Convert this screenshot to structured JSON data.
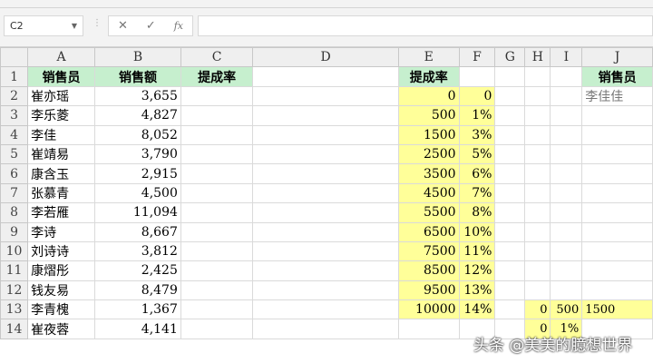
{
  "formula_bar": {
    "name_box": "C2",
    "cancel": "✕",
    "confirm": "✓",
    "fx": "fx",
    "value": ""
  },
  "columns": [
    "A",
    "B",
    "C",
    "D",
    "E",
    "F",
    "G",
    "H",
    "I",
    "J"
  ],
  "rows": [
    [
      "销售员",
      "销售额",
      "提成率",
      "",
      "提成率",
      "",
      "",
      "",
      "",
      "销售员"
    ],
    [
      "崔亦瑶",
      "3,655",
      "",
      "",
      "0",
      "0",
      "",
      "",
      "",
      "李佳佳"
    ],
    [
      "李乐菱",
      "4,827",
      "",
      "",
      "500",
      "1%",
      "",
      "",
      "",
      ""
    ],
    [
      "李佳",
      "8,052",
      "",
      "",
      "1500",
      "3%",
      "",
      "",
      "",
      ""
    ],
    [
      "崔靖易",
      "3,790",
      "",
      "",
      "2500",
      "5%",
      "",
      "",
      "",
      ""
    ],
    [
      "康含玉",
      "2,915",
      "",
      "",
      "3500",
      "6%",
      "",
      "",
      "",
      ""
    ],
    [
      "张慕青",
      "4,500",
      "",
      "",
      "4500",
      "7%",
      "",
      "",
      "",
      ""
    ],
    [
      "李若雁",
      "11,094",
      "",
      "",
      "5500",
      "8%",
      "",
      "",
      "",
      ""
    ],
    [
      "李诗",
      "8,667",
      "",
      "",
      "6500",
      "10%",
      "",
      "",
      "",
      ""
    ],
    [
      "刘诗诗",
      "3,812",
      "",
      "",
      "7500",
      "11%",
      "",
      "",
      "",
      ""
    ],
    [
      "康熠彤",
      "2,425",
      "",
      "",
      "8500",
      "12%",
      "",
      "",
      "",
      ""
    ],
    [
      "钱友易",
      "8,479",
      "",
      "",
      "9500",
      "13%",
      "",
      "",
      "",
      ""
    ],
    [
      "李青槐",
      "1,367",
      "",
      "",
      "10000",
      "14%",
      "",
      "0",
      "500",
      "1500"
    ],
    [
      "崔夜蓉",
      "4,141",
      "",
      "",
      "",
      "",
      "",
      "0",
      "1%",
      ""
    ]
  ],
  "watermark": "头条 @美美的臆想世界"
}
